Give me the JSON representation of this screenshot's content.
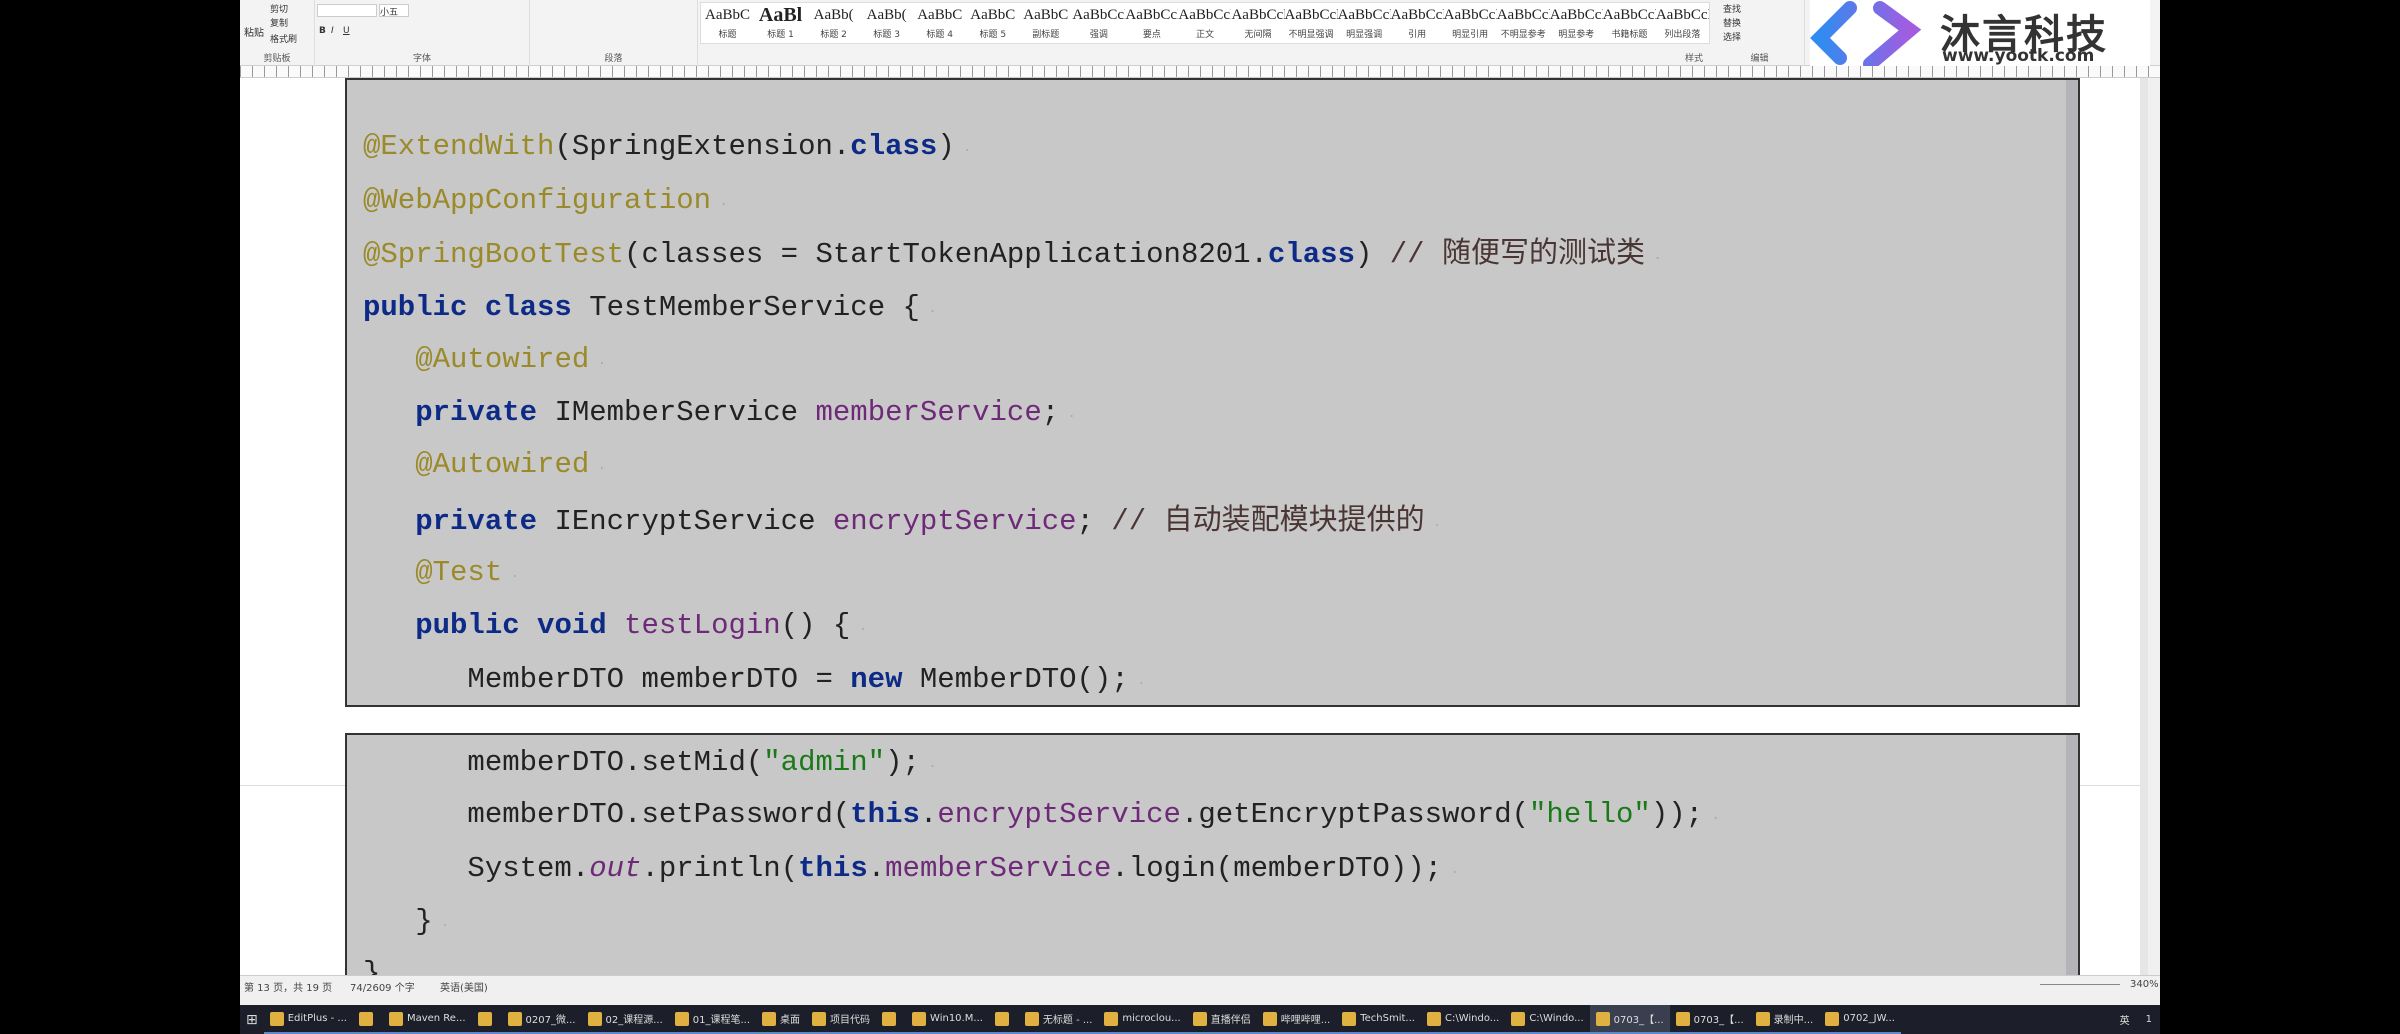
{
  "ribbon": {
    "clipboard": {
      "paste": "粘贴",
      "cut": "剪切",
      "copy": "复制",
      "format_painter": "格式刷",
      "label": "剪贴板"
    },
    "font": {
      "size": "小五",
      "label": "字体",
      "bold": "B",
      "italic": "I",
      "underline": "U"
    },
    "paragraph": {
      "label": "段落"
    },
    "styles": {
      "label": "样式",
      "items": [
        {
          "preview": "AaBbC",
          "name": "标题"
        },
        {
          "preview": "AaBl",
          "name": "标题 1"
        },
        {
          "preview": "AaBb(",
          "name": "标题 2"
        },
        {
          "preview": "AaBb(",
          "name": "标题 3"
        },
        {
          "preview": "AaBbC",
          "name": "标题 4"
        },
        {
          "preview": "AaBbC",
          "name": "标题 5"
        },
        {
          "preview": "AaBbC",
          "name": "副标题"
        },
        {
          "preview": "AaBbCcDc",
          "name": "强调"
        },
        {
          "preview": "AaBbCcD",
          "name": "要点"
        },
        {
          "preview": "AaBbCcDc",
          "name": "正文"
        },
        {
          "preview": "AaBbCcDc",
          "name": "无间隔"
        },
        {
          "preview": "AaBbCcDc",
          "name": "不明显强调"
        },
        {
          "preview": "AaBbCcDc",
          "name": "明显强调"
        },
        {
          "preview": "AaBbCcDc",
          "name": "引用"
        },
        {
          "preview": "AaBbCcDc",
          "name": "明显引用"
        },
        {
          "preview": "AaBbCcD",
          "name": "不明显参考"
        },
        {
          "preview": "AaBbCcI",
          "name": "明显参考"
        },
        {
          "preview": "AaBbCcD",
          "name": "书籍标题"
        },
        {
          "preview": "AaBbCcDc",
          "name": "列出段落"
        }
      ]
    },
    "editing": {
      "find": "查找",
      "replace": "替换",
      "select": "选择",
      "label": "编辑"
    }
  },
  "logo": {
    "name": "沐言科技",
    "url": "www.yootk.com",
    "colors": [
      "#2f8cf0",
      "#a35ce0"
    ]
  },
  "code_block_1": [
    [
      {
        "t": "@ExtendWith",
        "c": "an"
      },
      {
        "t": "(SpringExtension."
      },
      {
        "t": "class",
        "c": "kw"
      },
      {
        "t": ")"
      }
    ],
    [
      {
        "t": "@WebAppConfiguration",
        "c": "an"
      }
    ],
    [
      {
        "t": "@SpringBootTest",
        "c": "an"
      },
      {
        "t": "(classes = StartTokenApplication8201."
      },
      {
        "t": "class",
        "c": "kw"
      },
      {
        "t": ") "
      },
      {
        "t": "// 随便写的测试类",
        "c": "cm"
      }
    ],
    [
      {
        "t": "public class",
        "c": "kw"
      },
      {
        "t": " TestMemberService {"
      }
    ],
    [
      {
        "t": "   "
      },
      {
        "t": "@Autowired",
        "c": "an"
      }
    ],
    [
      {
        "t": "   "
      },
      {
        "t": "private",
        "c": "kw"
      },
      {
        "t": " IMemberService "
      },
      {
        "t": "memberService",
        "c": "fd"
      },
      {
        "t": ";"
      }
    ],
    [
      {
        "t": "   "
      },
      {
        "t": "@Autowired",
        "c": "an"
      }
    ],
    [
      {
        "t": "   "
      },
      {
        "t": "private",
        "c": "kw"
      },
      {
        "t": " IEncryptService "
      },
      {
        "t": "encryptService",
        "c": "fd"
      },
      {
        "t": "; "
      },
      {
        "t": "// 自动装配模块提供的",
        "c": "cm"
      }
    ],
    [
      {
        "t": "   "
      },
      {
        "t": "@Test",
        "c": "an"
      }
    ],
    [
      {
        "t": "   "
      },
      {
        "t": "public void",
        "c": "kw"
      },
      {
        "t": " "
      },
      {
        "t": "testLogin",
        "c": "fd"
      },
      {
        "t": "() {"
      }
    ],
    [
      {
        "t": "      MemberDTO memberDTO = "
      },
      {
        "t": "new",
        "c": "kw"
      },
      {
        "t": " MemberDTO();"
      }
    ]
  ],
  "code_block_2": [
    [
      {
        "t": "      memberDTO.setMid("
      },
      {
        "t": "\"admin\"",
        "c": "st"
      },
      {
        "t": ");"
      }
    ],
    [
      {
        "t": "      memberDTO.setPassword("
      },
      {
        "t": "this",
        "c": "kw"
      },
      {
        "t": "."
      },
      {
        "t": "encryptService",
        "c": "fd"
      },
      {
        "t": ".getEncryptPassword("
      },
      {
        "t": "\"hello\"",
        "c": "st"
      },
      {
        "t": "));"
      }
    ],
    [
      {
        "t": "      System."
      },
      {
        "t": "out",
        "c": "it"
      },
      {
        "t": ".println("
      },
      {
        "t": "this",
        "c": "kw"
      },
      {
        "t": "."
      },
      {
        "t": "memberService",
        "c": "fd"
      },
      {
        "t": ".login(memberDTO));"
      }
    ],
    [
      {
        "t": "   }"
      }
    ],
    [
      {
        "t": "}"
      }
    ]
  ],
  "status": {
    "page": "第 13 页，共 19 页",
    "words": "74/2609 个字",
    "language": "英语(美国)",
    "zoom": "340%"
  },
  "taskbar": {
    "items": [
      "EditPlus - ...",
      "",
      "Maven Re...",
      "",
      "0207_微...",
      "02_课程源...",
      "01_课程笔...",
      "桌面",
      "项目代码",
      "",
      "Win10.M...",
      "",
      "无标题 - ...",
      "microclou...",
      "直播伴侣",
      "哔哩哔哩...",
      "TechSmit...",
      "C:\\Windo...",
      "C:\\Windo...",
      "0703_【...",
      "0703_【...",
      "录制中...",
      "0702_JW..."
    ],
    "tray": "英",
    "notifications": "1"
  }
}
